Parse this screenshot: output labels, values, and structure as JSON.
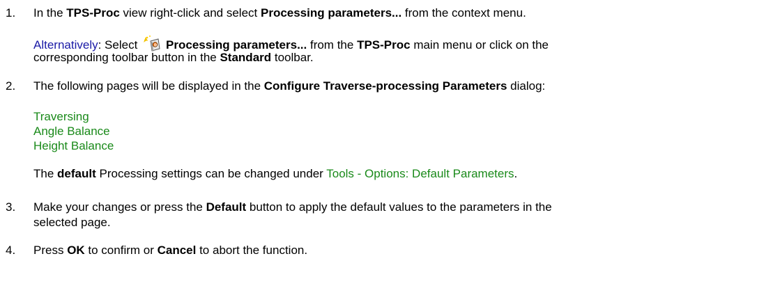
{
  "steps": [
    {
      "num": "1.",
      "pre": "In the ",
      "view": "TPS-Proc",
      "mid": " view right-click and select ",
      "item": "Processing parameters...",
      "post": " from the context menu."
    },
    {
      "num": "2.",
      "pre": "The following pages will be displayed in the ",
      "dialog": "Configure Traverse-processing Parameters",
      "post": " dialog:"
    },
    {
      "num": "3.",
      "pre": "Make your changes or press the ",
      "button": "Default",
      "post1": " button to apply the default values to the parameters in the",
      "post2": "selected page."
    },
    {
      "num": "4.",
      "pre": "Press ",
      "ok": "OK",
      "mid": " to confirm or ",
      "cancel": "Cancel",
      "post": " to abort the function."
    }
  ],
  "alternatively": {
    "label": "Alternatively",
    "pre": ": Select ",
    "item": "Processing parameters...",
    "mid": " from the ",
    "menu": "TPS-Proc",
    "post1": " main menu or click on the",
    "post2a": "corresponding toolbar button in the ",
    "toolbar": "Standard",
    "post2b": " toolbar.",
    "icon": "processing-parameters-icon"
  },
  "pages": [
    "Traversing",
    "Angle Balance",
    "Height Balance"
  ],
  "default_note": {
    "pre": "The ",
    "bold": "default",
    "mid": " Processing settings can be changed under ",
    "link": "Tools - Options: Default Parameters",
    "post": "."
  },
  "colors": {
    "note": "#1a1aa6",
    "link": "#1a8a1a"
  }
}
